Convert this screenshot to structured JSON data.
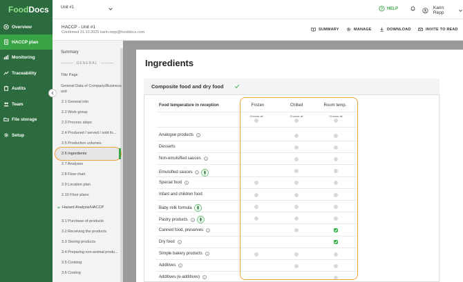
{
  "app": {
    "logo": "FoodDocs"
  },
  "sidebar": {
    "items": [
      {
        "label": "Overview",
        "icon": "target-icon"
      },
      {
        "label": "HACCP plan",
        "icon": "document-icon",
        "active": true
      },
      {
        "label": "Monitoring",
        "icon": "chart-icon"
      },
      {
        "label": "Traceability",
        "icon": "trace-icon"
      },
      {
        "label": "Audits",
        "icon": "clipboard-icon"
      },
      {
        "label": "Team",
        "icon": "team-icon"
      },
      {
        "label": "File storage",
        "icon": "folder-icon"
      },
      {
        "label": "Setup",
        "icon": "gear-icon"
      }
    ]
  },
  "topbar": {
    "unit": "Unit #1",
    "help": "HELP",
    "user": "Karin Repp"
  },
  "doc": {
    "title": "HACCP - Unit #1",
    "subtitle": "Confirmed 31.10.2025 karin.repp@fooddocs.com",
    "actions": {
      "summary": "SUMMARY",
      "manage": "MANAGE",
      "download": "DOWNLOAD",
      "invite": "INVITE TO READ"
    }
  },
  "toc": {
    "summary": "Summary",
    "general_section": "GENERAL",
    "items": [
      "Title Page",
      "General Data of Company/Business unit",
      "2.1 General info",
      "2.2 Work group",
      "2.3 Process steps",
      "2.4 Produced / served / sold fo...",
      "2.5 Production volumes",
      "2.6 Ingredients",
      "2.7 Analyses",
      "2.8 Flow chart",
      "2.9 Location plan",
      "2.10 Floor plans"
    ],
    "hazard_heading": "Hazard Analysis/HACCP",
    "hazard_items": [
      "3.1 Purchase of products",
      "3.2 Receiving the products",
      "3.3 Storing products",
      "3.4 Preparing non-animal produ...",
      "3.5 Cooking",
      "3.6 Cooling"
    ]
  },
  "main": {
    "page_title": "Ingredients",
    "section_title": "Composite food and dry food",
    "table": {
      "header": "Food temperature in reception",
      "columns": [
        "Frozen",
        "Chilled",
        "Room temp."
      ],
      "choose_all": "Choose all",
      "rows": [
        {
          "label": "Analogue products",
          "info": true,
          "badge": false,
          "cells": [
            false,
            true,
            true
          ],
          "checked": [
            false,
            false,
            false
          ]
        },
        {
          "label": "Desserts",
          "info": false,
          "badge": false,
          "cells": [
            false,
            true,
            true
          ],
          "checked": [
            false,
            false,
            false
          ]
        },
        {
          "label": "Non-emulsified sauces",
          "info": true,
          "badge": false,
          "cells": [
            false,
            true,
            true
          ],
          "checked": [
            false,
            false,
            false
          ]
        },
        {
          "label": "Emulsified sauces",
          "info": true,
          "badge": true,
          "cells": [
            false,
            true,
            true
          ],
          "checked": [
            false,
            false,
            false
          ]
        },
        {
          "label": "Special food",
          "info": true,
          "badge": false,
          "cells": [
            true,
            true,
            true
          ],
          "checked": [
            false,
            false,
            false
          ]
        },
        {
          "label": "Infant and children food",
          "info": false,
          "badge": false,
          "cells": [
            true,
            true,
            true
          ],
          "checked": [
            false,
            false,
            false
          ]
        },
        {
          "label": "Baby milk formula",
          "info": false,
          "badge": true,
          "cells": [
            true,
            true,
            true
          ],
          "checked": [
            false,
            false,
            false
          ]
        },
        {
          "label": "Pastry products",
          "info": true,
          "badge": true,
          "cells": [
            true,
            true,
            true
          ],
          "checked": [
            false,
            false,
            false
          ]
        },
        {
          "label": "Canned food, preserves",
          "info": true,
          "badge": false,
          "cells": [
            false,
            true,
            true
          ],
          "checked": [
            false,
            false,
            true
          ]
        },
        {
          "label": "Dry food",
          "info": true,
          "badge": false,
          "cells": [
            false,
            false,
            true
          ],
          "checked": [
            false,
            false,
            true
          ]
        },
        {
          "label": "Simple bakery products",
          "info": true,
          "badge": false,
          "cells": [
            true,
            true,
            true
          ],
          "checked": [
            false,
            false,
            false
          ]
        },
        {
          "label": "Additives",
          "info": true,
          "badge": false,
          "cells": [
            false,
            true,
            true
          ],
          "checked": [
            false,
            false,
            false
          ]
        },
        {
          "label": "Additives (e-additives)",
          "info": true,
          "badge": false,
          "cells": [
            false,
            false,
            true
          ],
          "checked": [
            false,
            false,
            false
          ]
        }
      ]
    }
  },
  "colors": {
    "sidebar": "#2b6b3e",
    "active": "#3aa546",
    "highlight": "#f0a23c",
    "checked": "#2fb34a"
  }
}
